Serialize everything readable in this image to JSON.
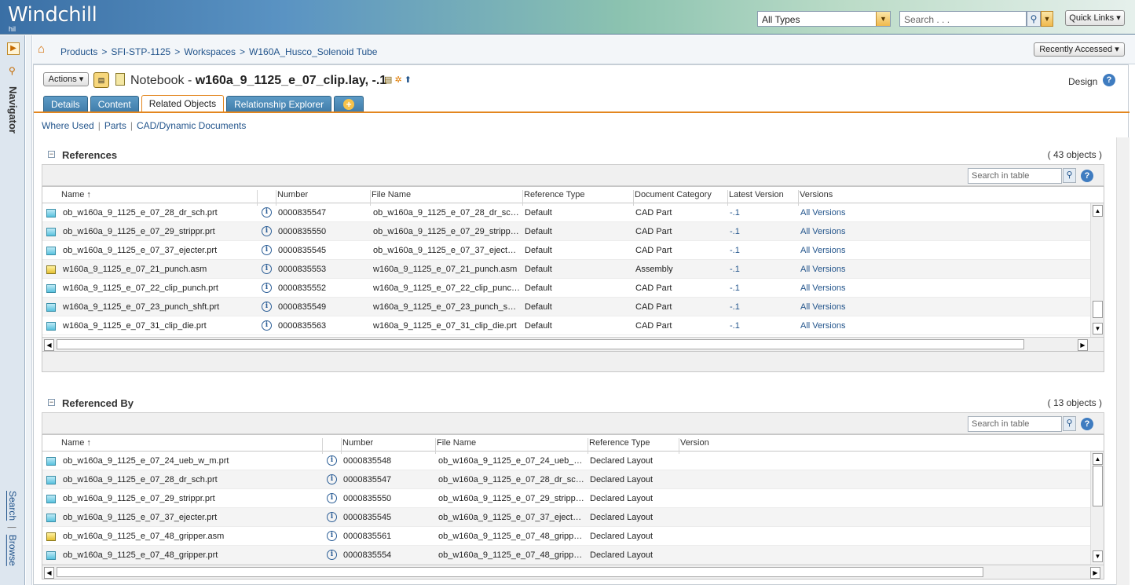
{
  "header": {
    "logo": "Windchill",
    "logo_sub": "hil",
    "type_select": "All Types",
    "search_placeholder": "Search . . .",
    "quick_links": "Quick Links ▾"
  },
  "nav": {
    "label": "Navigator",
    "search": "Search",
    "browse": "Browse"
  },
  "breadcrumb": {
    "items": [
      "Products",
      "SFI-STP-1125",
      "Workspaces",
      "W160A_Husco_Solenoid Tube"
    ],
    "separator": ">",
    "recently_accessed": "Recently Accessed ▾"
  },
  "page": {
    "actions_label": "Actions ▾",
    "title_prefix": "Notebook - ",
    "title_name": "w160a_9_1125_e_07_clip.lay, -.1",
    "design_label": "Design",
    "tabs": [
      "Details",
      "Content",
      "Related Objects",
      "Relationship Explorer",
      "+"
    ],
    "subtabs": [
      "Where Used",
      "Parts",
      "CAD/Dynamic Documents"
    ]
  },
  "references": {
    "title": "References",
    "count": "( 43 objects )",
    "search_placeholder": "Search in table",
    "columns": [
      "Name ↑",
      "Number",
      "File Name",
      "Reference Type",
      "Document Category",
      "Latest Version",
      "Versions"
    ],
    "rows": [
      {
        "icon": "part",
        "name": "ob_w160a_9_1125_e_07_28_dr_sch.prt",
        "number": "0000835547",
        "file": "ob_w160a_9_1125_e_07_28_dr_sch....",
        "ref_type": "Default",
        "category": "CAD Part",
        "latest": "-.1",
        "versions": "All Versions"
      },
      {
        "icon": "part",
        "name": "ob_w160a_9_1125_e_07_29_strippr.prt",
        "number": "0000835550",
        "file": "ob_w160a_9_1125_e_07_29_strippr....",
        "ref_type": "Default",
        "category": "CAD Part",
        "latest": "-.1",
        "versions": "All Versions"
      },
      {
        "icon": "part",
        "name": "ob_w160a_9_1125_e_07_37_ejecter.prt",
        "number": "0000835545",
        "file": "ob_w160a_9_1125_e_07_37_ejecter....",
        "ref_type": "Default",
        "category": "CAD Part",
        "latest": "-.1",
        "versions": "All Versions"
      },
      {
        "icon": "asm",
        "name": "w160a_9_1125_e_07_21_punch.asm",
        "number": "0000835553",
        "file": "w160a_9_1125_e_07_21_punch.asm",
        "ref_type": "Default",
        "category": "Assembly",
        "latest": "-.1",
        "versions": "All Versions"
      },
      {
        "icon": "part",
        "name": "w160a_9_1125_e_07_22_clip_punch.prt",
        "number": "0000835552",
        "file": "w160a_9_1125_e_07_22_clip_punch....",
        "ref_type": "Default",
        "category": "CAD Part",
        "latest": "-.1",
        "versions": "All Versions"
      },
      {
        "icon": "part",
        "name": "w160a_9_1125_e_07_23_punch_shft.prt",
        "number": "0000835549",
        "file": "w160a_9_1125_e_07_23_punch_shft....",
        "ref_type": "Default",
        "category": "CAD Part",
        "latest": "-.1",
        "versions": "All Versions"
      },
      {
        "icon": "part",
        "name": "w160a_9_1125_e_07_31_clip_die.prt",
        "number": "0000835563",
        "file": "w160a_9_1125_e_07_31_clip_die.prt",
        "ref_type": "Default",
        "category": "CAD Part",
        "latest": "-.1",
        "versions": "All Versions"
      }
    ]
  },
  "referenced_by": {
    "title": "Referenced By",
    "count": "( 13 objects )",
    "search_placeholder": "Search in table",
    "columns": [
      "Name ↑",
      "Number",
      "File Name",
      "Reference Type",
      "Version"
    ],
    "rows": [
      {
        "icon": "part",
        "name": "ob_w160a_9_1125_e_07_24_ueb_w_m.prt",
        "number": "0000835548",
        "file": "ob_w160a_9_1125_e_07_24_ueb_w_...",
        "ref_type": "Declared Layout",
        "version": ""
      },
      {
        "icon": "part",
        "name": "ob_w160a_9_1125_e_07_28_dr_sch.prt",
        "number": "0000835547",
        "file": "ob_w160a_9_1125_e_07_28_dr_sch....",
        "ref_type": "Declared Layout",
        "version": ""
      },
      {
        "icon": "part",
        "name": "ob_w160a_9_1125_e_07_29_strippr.prt",
        "number": "0000835550",
        "file": "ob_w160a_9_1125_e_07_29_strippr....",
        "ref_type": "Declared Layout",
        "version": ""
      },
      {
        "icon": "part",
        "name": "ob_w160a_9_1125_e_07_37_ejecter.prt",
        "number": "0000835545",
        "file": "ob_w160a_9_1125_e_07_37_ejecter....",
        "ref_type": "Declared Layout",
        "version": ""
      },
      {
        "icon": "asm",
        "name": "ob_w160a_9_1125_e_07_48_gripper.asm",
        "number": "0000835561",
        "file": "ob_w160a_9_1125_e_07_48_gripper....",
        "ref_type": "Declared Layout",
        "version": ""
      },
      {
        "icon": "part",
        "name": "ob_w160a_9_1125_e_07_48_gripper.prt",
        "number": "0000835554",
        "file": "ob_w160a_9_1125_e_07_48_gripper....",
        "ref_type": "Declared Layout",
        "version": ""
      }
    ]
  }
}
